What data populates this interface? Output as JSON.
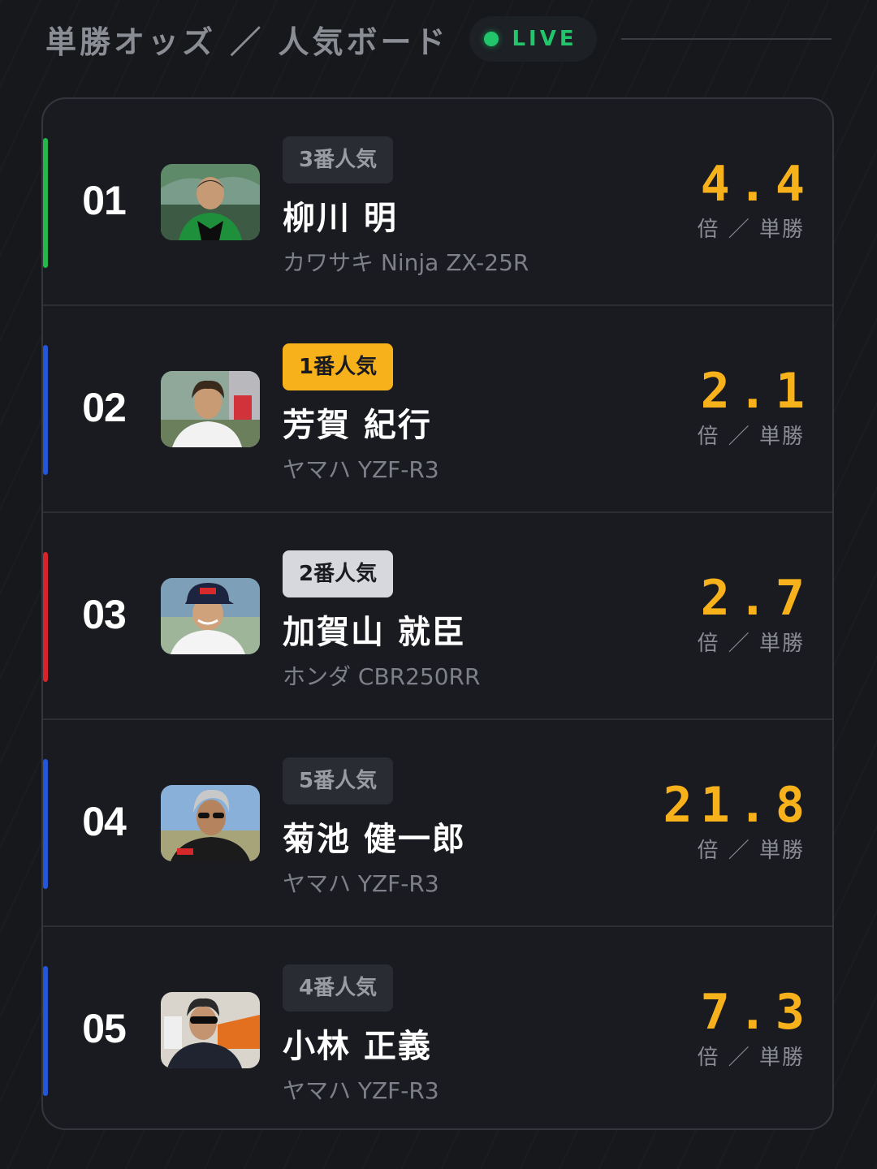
{
  "header": {
    "title": "単勝オッズ ／ 人気ボード",
    "live_label": "LIVE",
    "live_color": "#22c66a"
  },
  "colors": {
    "accent_gold": "#f7b11b",
    "team_green": "#22b84a",
    "team_blue": "#2456d8",
    "team_red": "#d8222c"
  },
  "riders": [
    {
      "number": "01",
      "rank_label": "3番人気",
      "rank_style": "default",
      "name": "柳川 明",
      "machine": "カワサキ Ninja ZX-25R",
      "odds": "4.4",
      "odds_unit": "倍 ／ 単勝",
      "team_color": "#22b84a",
      "photo_icon": "rider-portrait-icon"
    },
    {
      "number": "02",
      "rank_label": "1番人気",
      "rank_style": "gold",
      "name": "芳賀 紀行",
      "machine": "ヤマハ YZF-R3",
      "odds": "2.1",
      "odds_unit": "倍 ／ 単勝",
      "team_color": "#2456d8",
      "photo_icon": "rider-portrait-icon"
    },
    {
      "number": "03",
      "rank_label": "2番人気",
      "rank_style": "silver",
      "name": "加賀山 就臣",
      "machine": "ホンダ CBR250RR",
      "odds": "2.7",
      "odds_unit": "倍 ／ 単勝",
      "team_color": "#d8222c",
      "photo_icon": "rider-portrait-icon"
    },
    {
      "number": "04",
      "rank_label": "5番人気",
      "rank_style": "default",
      "name": "菊池 健一郎",
      "machine": "ヤマハ YZF-R3",
      "odds": "21.8",
      "odds_unit": "倍 ／ 単勝",
      "team_color": "#2456d8",
      "photo_icon": "rider-portrait-icon"
    },
    {
      "number": "05",
      "rank_label": "4番人気",
      "rank_style": "default",
      "name": "小林 正義",
      "machine": "ヤマハ YZF-R3",
      "odds": "7.3",
      "odds_unit": "倍 ／ 単勝",
      "team_color": "#2456d8",
      "photo_icon": "rider-portrait-icon"
    }
  ]
}
